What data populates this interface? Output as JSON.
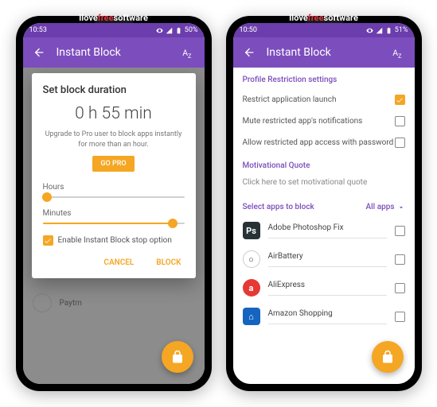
{
  "watermark": {
    "pre": "Ilove",
    "mid": "free",
    "post": "software"
  },
  "status": {
    "time1": "10:53",
    "time2": "10:50",
    "batt1": "50%",
    "batt2": "51%"
  },
  "appbar": {
    "title": "Instant Block"
  },
  "dialog": {
    "title": "Set block duration",
    "duration": "0 h  55 min",
    "upgrade": "Upgrade to Pro user to block apps instantly for more than an hour.",
    "gopro": "GO PRO",
    "hours_label": "Hours",
    "minutes_label": "Minutes",
    "hours_pct": 3,
    "minutes_pct": 92,
    "enable_stop": "Enable Instant Block stop option",
    "cancel": "CANCEL",
    "block": "BLOCK"
  },
  "bg_apps": [
    {
      "color": "#b71c1c"
    },
    {
      "color": "#ff9800"
    },
    {
      "color": "#039be5"
    },
    {
      "color": "#e53935"
    },
    {
      "color": "#ff7043"
    },
    {
      "color": "#3f51b5"
    }
  ],
  "bg_last": "Paytm",
  "settings": {
    "profile_header": "Profile Restriction settings",
    "rows": [
      {
        "label": "Restrict application launch",
        "checked": true
      },
      {
        "label": "Mute restricted app's notifications",
        "checked": false
      },
      {
        "label": "Allow restricted app access with password",
        "checked": false
      }
    ],
    "quote_header": "Motivational Quote",
    "quote_hint": "Click here to set motivational quote"
  },
  "select": {
    "label": "Select apps to block",
    "filter": "All apps"
  },
  "apps": [
    {
      "name": "Adobe Photoshop Fix",
      "bg": "#263238",
      "glyph": "Ps"
    },
    {
      "name": "AirBattery",
      "bg": "#ffffff",
      "glyph": "○",
      "fg": "#333",
      "round": true
    },
    {
      "name": "AliExpress",
      "bg": "#e53935",
      "glyph": "a",
      "round": true
    },
    {
      "name": "Amazon Shopping",
      "bg": "#1565c0",
      "glyph": "⌂"
    }
  ]
}
